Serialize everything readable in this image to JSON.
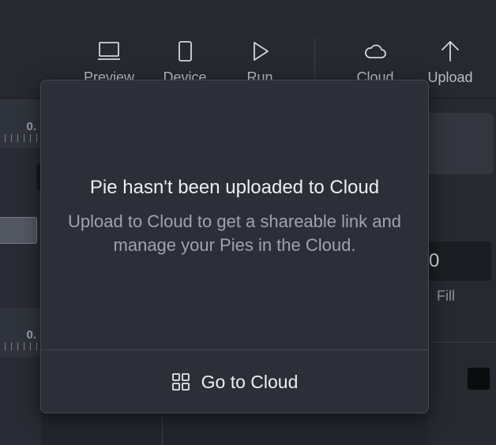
{
  "toolbar": {
    "items": [
      {
        "label": "Preview",
        "icon": "laptop-icon"
      },
      {
        "label": "Device",
        "icon": "phone-icon"
      },
      {
        "label": "Run",
        "icon": "play-icon"
      },
      {
        "label": "Cloud",
        "icon": "cloud-icon"
      },
      {
        "label": "Upload",
        "icon": "arrow-up-icon"
      }
    ]
  },
  "left_panel": {
    "ruler_top_value": "0.",
    "ruler_bottom_value": "0."
  },
  "right_panel": {
    "field_value": "0",
    "fill_label": "Fill",
    "swatch_color": "#0b0c0e"
  },
  "popover": {
    "title": "Pie hasn't been uploaded to Cloud",
    "body": "Upload to Cloud to get a shareable link and manage your Pies in the Cloud.",
    "action_label": "Go to Cloud",
    "action_icon": "grid-icon"
  },
  "colors": {
    "background": "#22252c",
    "popover_bg": "#2c2f38",
    "text_primary": "#eceef2",
    "text_secondary": "#9ea3ad"
  }
}
